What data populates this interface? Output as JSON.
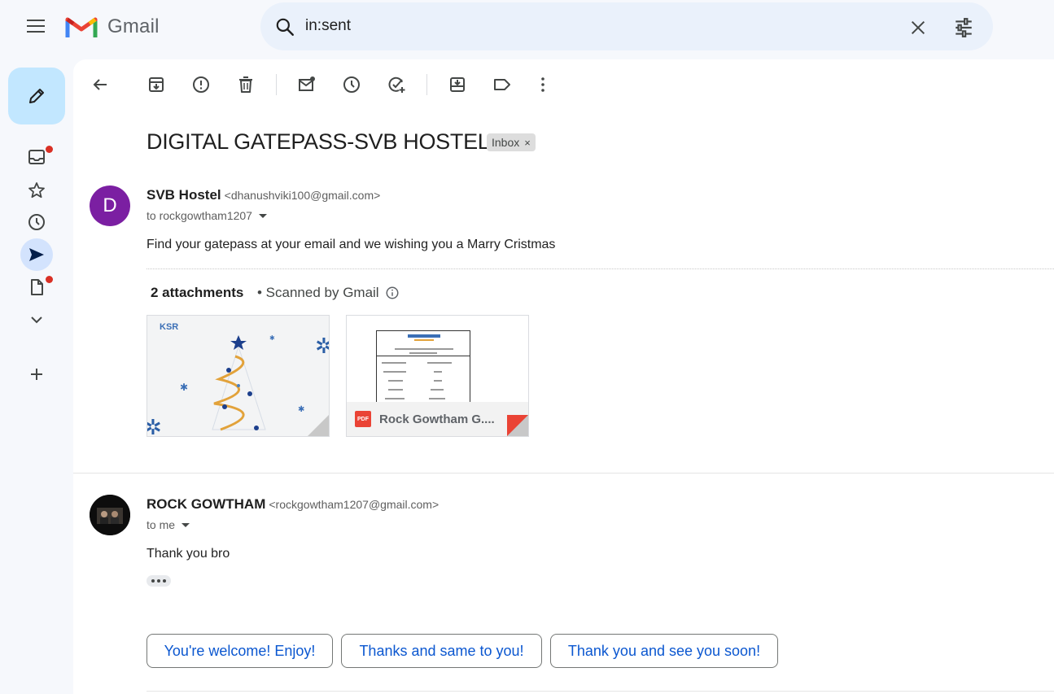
{
  "header": {
    "app_name": "Gmail",
    "search_query": "in:sent"
  },
  "thread": {
    "subject": "DIGITAL GATEPASS-SVB HOSTEL",
    "label": "Inbox",
    "label_remove": "×"
  },
  "message1": {
    "avatar_letter": "D",
    "sender_name": "SVB Hostel",
    "sender_email": "<dhanushviki100@gmail.com>",
    "to": "to rockgowtham1207",
    "body": "Find your gatepass at your email and we wishing you a Marry Cristmas",
    "attachments_title": "2 attachments",
    "scanned_text": "• Scanned by Gmail",
    "attachments": [
      {
        "type": "image",
        "alt": "christmas-card"
      },
      {
        "type": "pdf",
        "name": "Rock Gowtham G...."
      }
    ],
    "pdf_badge": "PDF"
  },
  "message2": {
    "sender_name": "ROCK GOWTHAM",
    "sender_email": "<rockgowtham1207@gmail.com>",
    "to": "to me",
    "body": "Thank you bro"
  },
  "smart_replies": [
    "You're welcome! Enjoy!",
    "Thanks and same to you!",
    "Thank you and see you soon!"
  ],
  "colors": {
    "accent": "#0b57d0",
    "compose_bg": "#c2e7ff",
    "avatar_d": "#7b1fa2",
    "notification_dot": "#d93025"
  }
}
